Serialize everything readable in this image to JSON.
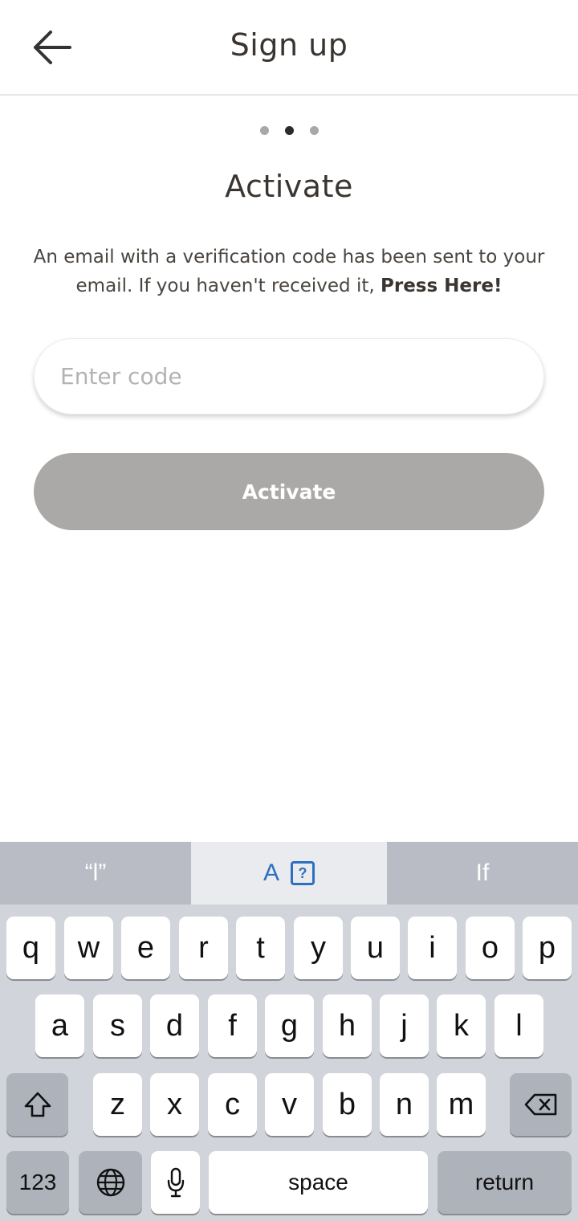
{
  "header": {
    "title": "Sign up"
  },
  "steps": {
    "total": 3,
    "current": 2
  },
  "main": {
    "heading": "Activate",
    "description": "An email with a verification code has been sent to your email. If you haven't received it, ",
    "resend_link": "Press Here!",
    "code_placeholder": "Enter code",
    "activate_label": "Activate"
  },
  "keyboard": {
    "suggestions": [
      "“l”",
      "A",
      "If"
    ],
    "row1": [
      "q",
      "w",
      "e",
      "r",
      "t",
      "y",
      "u",
      "i",
      "o",
      "p"
    ],
    "row2": [
      "a",
      "s",
      "d",
      "f",
      "g",
      "h",
      "j",
      "k",
      "l"
    ],
    "row3": [
      "z",
      "x",
      "c",
      "v",
      "b",
      "n",
      "m"
    ],
    "numbers_label": "123",
    "space_label": "space",
    "return_label": "return"
  }
}
